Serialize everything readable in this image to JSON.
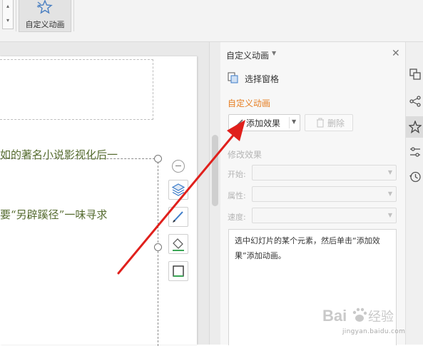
{
  "ribbon": {
    "custom_animation_label": "自定义动画"
  },
  "slide": {
    "line1": "如的著名小说影视化后一",
    "line2": "要“另辟蹊径”一味寻求"
  },
  "pane": {
    "title": "自定义动画",
    "selection_pane_label": "选择窗格",
    "section_title": "自定义动画",
    "add_effect_label": "添加效果",
    "delete_label": "删除",
    "modify_title": "修改效果",
    "start_label": "开始:",
    "property_label": "属性:",
    "speed_label": "速度:",
    "start_value": "",
    "property_value": "",
    "speed_value": "",
    "hint": "选中幻灯片的某个元素，然后单击“添加效果”添加动画。"
  },
  "icons": {
    "ribbon": "star-animation-icon",
    "selection_pane": "selection-pane-icon",
    "add_effect": "pencil-icon",
    "delete": "trash-icon",
    "close": "close-icon",
    "rail": [
      "slides-icon",
      "share-icon",
      "animation-star-icon",
      "properties-icon",
      "history-icon"
    ]
  },
  "watermark": {
    "logo_text": "Bai 经验",
    "url": "jingyan.baidu.com"
  },
  "colors": {
    "accent_orange": "#e67e22",
    "arrow_red": "#e0201c",
    "slide_text": "#556b2f"
  }
}
